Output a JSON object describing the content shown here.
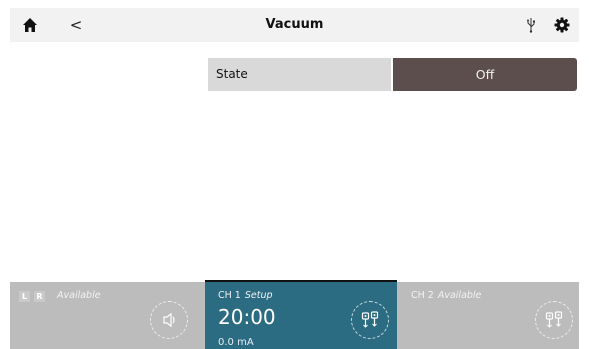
{
  "header": {
    "title": "Vacuum",
    "back_glyph": "<",
    "icons": [
      "home-icon",
      "back-chevron",
      "usb-icon",
      "gear-icon"
    ]
  },
  "settings": {
    "state_label": "State",
    "state_value": "Off"
  },
  "channels": {
    "left": {
      "badge_l": "L",
      "badge_r": "R",
      "status": "Available",
      "icon": "speaker-icon"
    },
    "ch1": {
      "name": "CH 1",
      "status": "Setup",
      "timer": "20:00",
      "current": "0.0 mA",
      "icon": "electrodes-icon"
    },
    "ch2": {
      "name": "CH 2",
      "status": "Available",
      "icon": "electrodes-icon"
    }
  },
  "colors": {
    "state_value_bg": "#5d4e4e",
    "active_channel_bg": "#2c6c82",
    "inactive_channel_bg": "#bcbcbc"
  }
}
